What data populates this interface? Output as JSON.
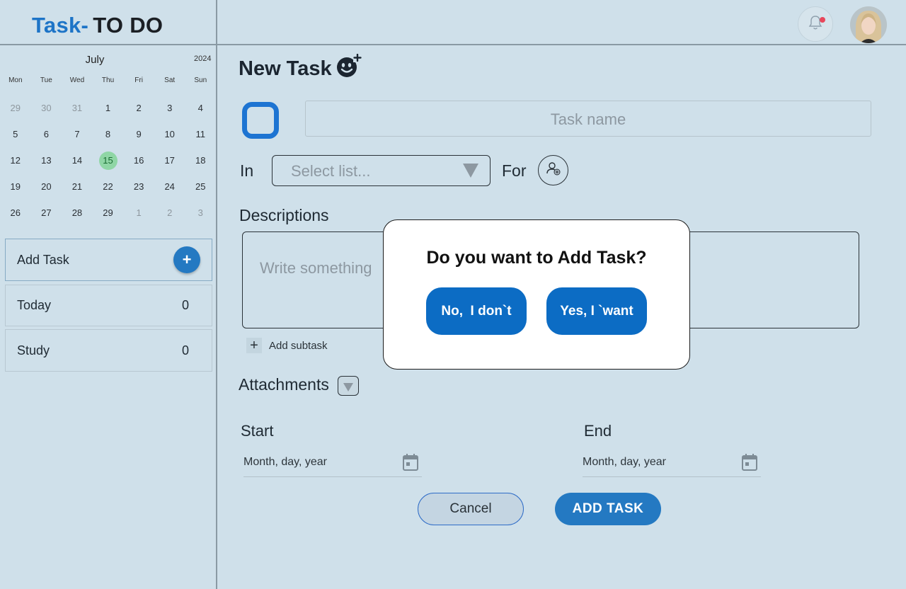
{
  "brand": {
    "part1": "Task-",
    "part2": "TO DO"
  },
  "calendar": {
    "month": "July",
    "year": "2024",
    "weekdays": [
      "Mon",
      "Tue",
      "Wed",
      "Thu",
      "Fri",
      "Sat",
      "Sun"
    ],
    "weeks": [
      [
        "29",
        "30",
        "31",
        "1",
        "2",
        "3",
        "4"
      ],
      [
        "5",
        "6",
        "7",
        "8",
        "9",
        "10",
        "11"
      ],
      [
        "12",
        "13",
        "14",
        "15",
        "16",
        "17",
        "18"
      ],
      [
        "19",
        "20",
        "21",
        "22",
        "23",
        "24",
        "25"
      ],
      [
        "26",
        "27",
        "28",
        "29",
        "1",
        "2",
        "3"
      ]
    ],
    "selected_day": "15"
  },
  "sidebar": {
    "add_task_label": "Add Task",
    "add_task_icon": "+",
    "lists": [
      {
        "label": "Today",
        "count": "0"
      },
      {
        "label": "Study",
        "count": "0"
      }
    ]
  },
  "form": {
    "title": "New Task",
    "task_name_placeholder": "Task name",
    "in_label": "In",
    "select_placeholder": "Select list...",
    "for_label": "For",
    "descriptions_label": "Descriptions",
    "description_placeholder": "Write something",
    "add_subtask_icon": "+",
    "add_subtask_label": "Add subtask",
    "attachments_label": "Attachments",
    "start_label": "Start",
    "end_label": "End",
    "start_placeholder": "Month, day, year",
    "end_placeholder": "Month, day, year",
    "cancel_label": "Cancel",
    "submit_label": "ADD TASK"
  },
  "modal": {
    "question": "Do you want to Add Task?",
    "no_label": "No,  I don`t",
    "yes_label": "Yes, I `want"
  },
  "colors": {
    "background": "#cfe0ea",
    "accent": "#2479c2",
    "checkbox": "#1d74d2",
    "today_highlight": "#8fd6a5",
    "notification_dot": "#e8475b"
  }
}
